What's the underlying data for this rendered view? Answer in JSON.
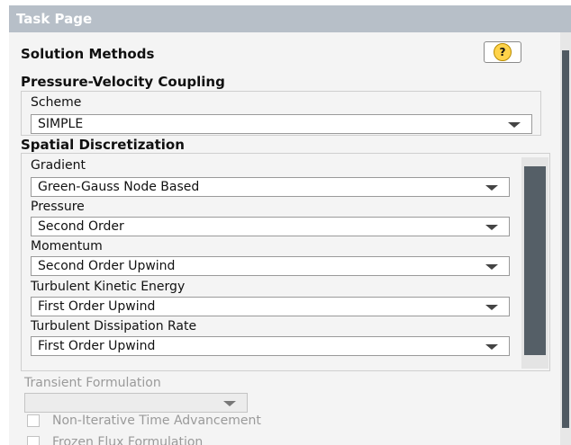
{
  "panel": {
    "title": "Task Page",
    "section_title": "Solution Methods",
    "help_icon": "question-icon"
  },
  "pressure_velocity": {
    "heading": "Pressure-Velocity Coupling",
    "scheme_label": "Scheme",
    "scheme_value": "SIMPLE"
  },
  "spatial": {
    "heading": "Spatial Discretization",
    "items": [
      {
        "label": "Gradient",
        "value": "Green-Gauss Node Based"
      },
      {
        "label": "Pressure",
        "value": "Second Order"
      },
      {
        "label": "Momentum",
        "value": "Second Order Upwind"
      },
      {
        "label": "Turbulent Kinetic Energy",
        "value": "First Order Upwind"
      },
      {
        "label": "Turbulent Dissipation Rate",
        "value": "First Order Upwind"
      }
    ]
  },
  "transient": {
    "label": "Transient Formulation",
    "value": ""
  },
  "options": [
    {
      "label": "Non-Iterative Time Advancement",
      "checked": false
    },
    {
      "label": "Frozen Flux Formulation",
      "checked": false
    }
  ]
}
